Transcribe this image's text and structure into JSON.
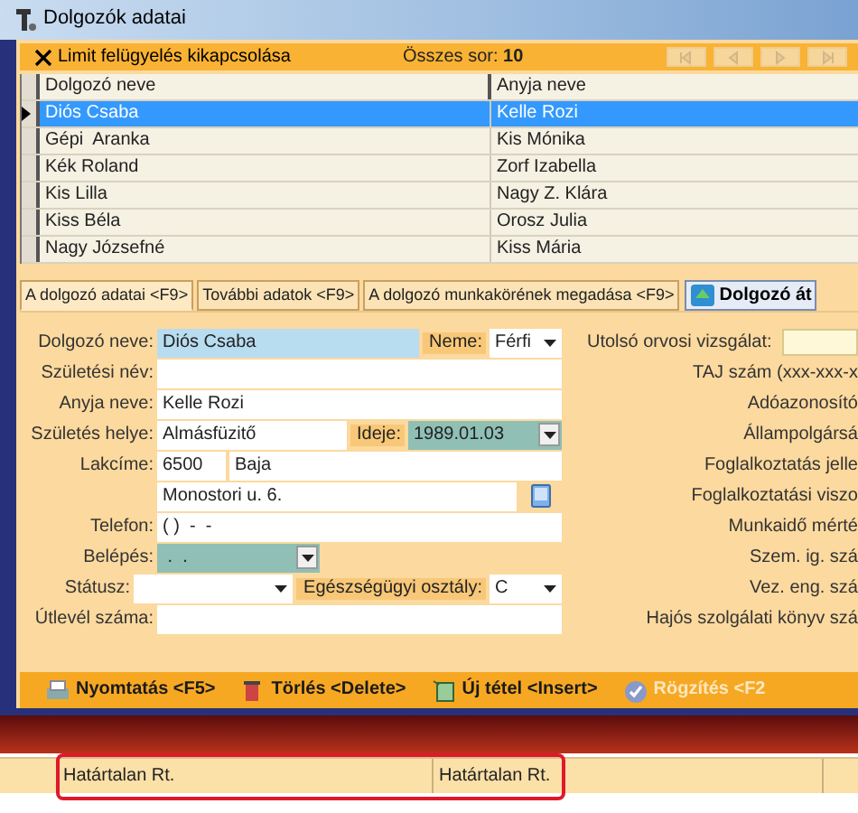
{
  "window": {
    "title": "Dolgozók adatai"
  },
  "toolbar": {
    "limit_button": "Limit felügyelés kikapcsolása",
    "count": "Összes sor: **10**",
    "nav_buttons": [
      {
        "kind": "first",
        "disabled": true
      },
      {
        "kind": "prev",
        "disabled": true
      },
      {
        "kind": "next",
        "disabled": true
      },
      {
        "kind": "last",
        "disabled": true
      }
    ]
  },
  "grid": {
    "columns": [
      "Dolgozó neve",
      "Anyja neve"
    ],
    "rows": [
      {
        "cells": [
          "Diós Csaba",
          "Kelle Rozi"
        ],
        "selected": true
      },
      {
        "cells": [
          "Gépi  Aranka",
          "Kis Mónika"
        ],
        "selected": false
      },
      {
        "cells": [
          "Kék Roland",
          "Zorf Izabella"
        ],
        "selected": false
      },
      {
        "cells": [
          "Kis Lilla",
          "Nagy Z. Klára"
        ],
        "selected": false
      },
      {
        "cells": [
          "Kiss Béla",
          "Orosz Julia"
        ],
        "selected": false
      },
      {
        "cells": [
          "Nagy Józsefné",
          "Kiss Mária"
        ],
        "selected": false
      }
    ]
  },
  "tabs": [
    {
      "label": "A dolgozó adatai <F9>",
      "selected": true
    },
    {
      "label": "További adatok <F9>",
      "selected": false
    },
    {
      "label": "A dolgozó munkakörének megadása <F9>",
      "selected": false
    }
  ],
  "transfer_button": "Dolgozó át",
  "form": {
    "left": [
      {
        "label": "Dolgozó neve:",
        "controls": [
          {
            "kind": "field",
            "value": "Diós Csaba",
            "focused": true
          },
          {
            "kind": "label",
            "text": "Neme:"
          },
          {
            "kind": "select",
            "value": "Férfi"
          }
        ]
      },
      {
        "label": "Születési név:",
        "controls": [
          {
            "kind": "field",
            "focused": false
          }
        ]
      },
      {
        "label": "Anyja neve:",
        "controls": [
          {
            "kind": "field",
            "value": "Kelle Rozi",
            "focused": false
          }
        ]
      },
      {
        "label": "Születés helye:",
        "controls": [
          {
            "kind": "field",
            "value": "Almásfüzitő",
            "focused": false
          },
          {
            "kind": "label",
            "text": "Ideje:"
          },
          {
            "kind": "date",
            "value": "1989.01.03"
          }
        ]
      },
      {
        "label": "Lakcíme:",
        "controls": [
          {
            "kind": "zip",
            "value": "6500"
          },
          {
            "kind": "field",
            "value": "Baja",
            "focused": false
          }
        ]
      },
      {
        "controls": [
          {
            "kind": "field",
            "value": "Monostori u. 6.",
            "focused": false
          },
          {
            "kind": "book"
          }
        ]
      },
      {
        "label": "Telefon:",
        "controls": [
          {
            "kind": "field",
            "value": "( )  -  -",
            "focused": false
          }
        ]
      },
      {
        "label": "Belépés:",
        "controls": [
          {
            "kind": "date",
            "value": " .  ."
          }
        ]
      },
      {
        "label": "Státusz:",
        "controls": [
          {
            "kind": "select"
          },
          {
            "kind": "label",
            "text": "Egészségügyi osztály:"
          },
          {
            "kind": "select",
            "value": "C"
          }
        ]
      },
      {
        "label": "Útlevél száma:",
        "controls": [
          {
            "kind": "field",
            "focused": false
          }
        ]
      }
    ],
    "right": [
      {
        "kind": "field",
        "label": "Utolsó orvosi vizsgálat:"
      },
      {
        "kind": "label",
        "label": "TAJ szám (xxx-xxx-x"
      },
      {
        "kind": "label",
        "label": "Adóazonosító"
      },
      {
        "kind": "label",
        "label": "Állampolgársá"
      },
      {
        "kind": "label",
        "label": "Foglalkoztatás jelle"
      },
      {
        "kind": "label",
        "label": "Foglalkoztatási viszo"
      },
      {
        "kind": "label",
        "label": "Munkaidő mérté"
      },
      {
        "kind": "label",
        "label": "Szem. ig. szá"
      },
      {
        "kind": "label",
        "label": "Vez. eng. szá"
      },
      {
        "kind": "label",
        "label": "Hajós szolgálati könyv szá"
      }
    ]
  },
  "actions": [
    {
      "kind": "print",
      "label": "Nyomtatás <F5>",
      "disabled": false
    },
    {
      "kind": "delete",
      "label": "Törlés <Delete>",
      "disabled": false
    },
    {
      "kind": "new",
      "label": "Új tétel <Insert>",
      "disabled": false
    },
    {
      "kind": "save",
      "label": "Rögzítés <F2",
      "disabled": true
    }
  ],
  "status_bar": {
    "panels": [
      "Határtalan Rt.",
      "Határtalan Rt."
    ],
    "highlighted": true
  }
}
